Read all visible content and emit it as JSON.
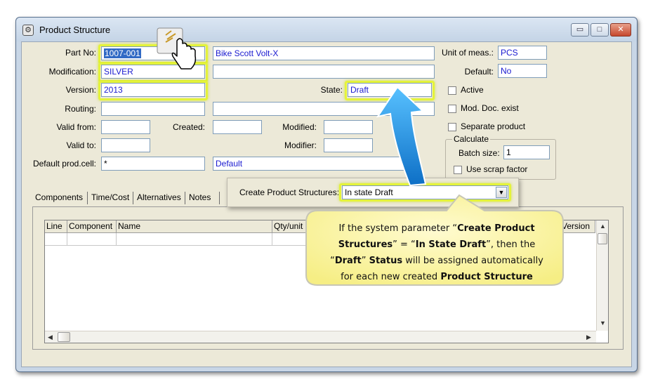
{
  "window": {
    "title": "Product Structure",
    "minimize_glyph": "▭",
    "maximize_glyph": "□",
    "close_glyph": "✕",
    "app_icon_glyph": "⚙"
  },
  "form": {
    "part_no": {
      "label": "Part No:",
      "value": "1007-001",
      "description": "Bike Scott Volt-X"
    },
    "modification": {
      "label": "Modification:",
      "value": "SILVER",
      "extra": ""
    },
    "version": {
      "label": "Version:",
      "value": "2013"
    },
    "state": {
      "label": "State:",
      "value": "Draft"
    },
    "routing": {
      "label": "Routing:",
      "value": "",
      "extra": ""
    },
    "valid_from": {
      "label": "Valid from:",
      "value": ""
    },
    "created": {
      "label": "Created:",
      "value": ""
    },
    "modified": {
      "label": "Modified:",
      "value": ""
    },
    "valid_to": {
      "label": "Valid to:",
      "value": ""
    },
    "modifier": {
      "label": "Modifier:",
      "value": ""
    },
    "default_prod_cell": {
      "label": "Default prod.cell:",
      "value": "*",
      "description": "Default"
    },
    "unit_of_meas": {
      "label": "Unit of meas.:",
      "value": "PCS"
    },
    "default": {
      "label": "Default:",
      "value": "No"
    },
    "active": {
      "label": "Active"
    },
    "mod_doc_exist": {
      "label": "Mod. Doc. exist"
    },
    "separate_product": {
      "label": "Separate product"
    },
    "calculate": {
      "title": "Calculate",
      "batch_size_label": "Batch size:",
      "batch_size_value": "1",
      "use_scrap_factor_label": "Use scrap factor"
    }
  },
  "tabs": [
    {
      "label": "Components"
    },
    {
      "label": "Time/Cost"
    },
    {
      "label": "Alternatives"
    },
    {
      "label": "Notes"
    }
  ],
  "grid": {
    "columns": [
      "Line",
      "Component",
      "Name",
      "Qty/unit",
      "Version"
    ]
  },
  "popup": {
    "label": "Create Product Structures:",
    "value": "In state Draft",
    "dropdown_glyph": "▼"
  },
  "callout": {
    "line1_a": "If the system parameter “",
    "line1_b": "Create Product",
    "line2_a": "Structures",
    "line2_b": "” = “",
    "line2_c": "In State Draft",
    "line2_d": "”, then the",
    "line3_a": "“",
    "line3_b": "Draft",
    "line3_c": "” ",
    "line3_d": "Status",
    "line3_e": " will be assigned automatically",
    "line4_a": "for each new created ",
    "line4_b": "Product Structure"
  },
  "colors": {
    "highlight": "#e4f33a",
    "callout_fill": "#fbf6a8",
    "arrow_blue": "#1a8be0",
    "field_text": "#1a1ad0"
  }
}
